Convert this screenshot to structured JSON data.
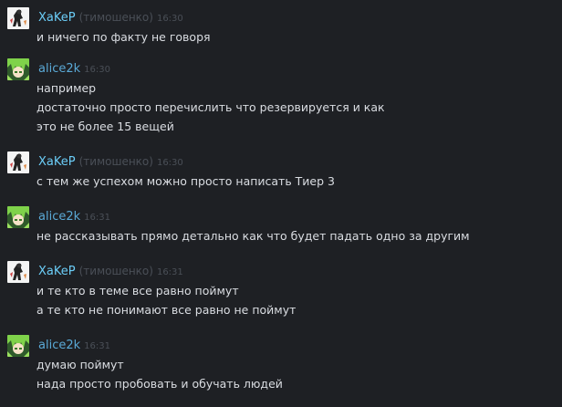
{
  "messages": [
    {
      "sender": "XaKeP",
      "nick": "(тимошенко)",
      "time": "16:30",
      "lines": [
        "и ничего по факту не говоря"
      ]
    },
    {
      "sender": "alice2k",
      "nick": "",
      "time": "16:30",
      "lines": [
        "например",
        "достаточно просто перечислить что резервируется и как",
        "это не более 15 вещей"
      ]
    },
    {
      "sender": "XaKeP",
      "nick": "(тимошенко)",
      "time": "16:30",
      "lines": [
        "с тем же успехом можно просто написать Тиер 3"
      ]
    },
    {
      "sender": "alice2k",
      "nick": "",
      "time": "16:31",
      "lines": [
        "не рассказывать прямо детально как что будет падать одно за другим"
      ]
    },
    {
      "sender": "XaKeP",
      "nick": "(тимошенко)",
      "time": "16:31",
      "lines": [
        "и те кто в теме все равно поймут",
        "а те кто не понимают все равно не поймут"
      ]
    },
    {
      "sender": "alice2k",
      "nick": "",
      "time": "16:31",
      "lines": [
        "думаю поймут",
        "нада просто пробовать и обучать людей"
      ]
    }
  ],
  "colors": {
    "background": "#1e2024",
    "xaker_name": "#6bcdf7",
    "alice_name": "#5aa9d6",
    "meta": "#4a4f57",
    "text": "#dadde2"
  }
}
